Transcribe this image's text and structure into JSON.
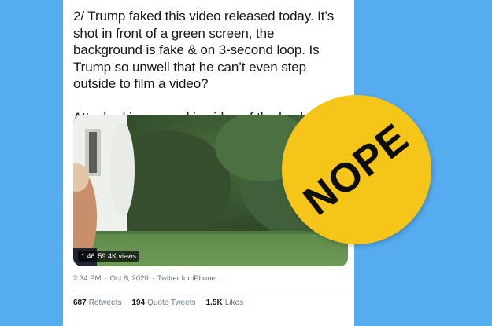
{
  "tweet": {
    "text": "2/ Trump faked this video released today. It’s shot in front of a green screen, the background is fake & on 3-second loop. Is Trump so unwell that he can’t even step outside to film a video?\n\nAttached is zoomed in video of the bushes to the right. On loop.",
    "video": {
      "duration": "1:46",
      "views": "59.4K views"
    },
    "time": "2:34 PM",
    "separator": "·",
    "date": "Oct 8, 2020",
    "source": "Twitter for iPhone",
    "stats": {
      "retweets_count": "687",
      "retweets_label": "Retweets",
      "quote_count": "194",
      "quote_label": "Quote Tweets",
      "likes_count": "1.5K",
      "likes_label": "Likes"
    }
  },
  "sticker": {
    "text": "NOPE",
    "color": "#f5c518"
  },
  "colors": {
    "background": "#55acee",
    "text": "#14171a",
    "secondary_text": "#657786"
  }
}
